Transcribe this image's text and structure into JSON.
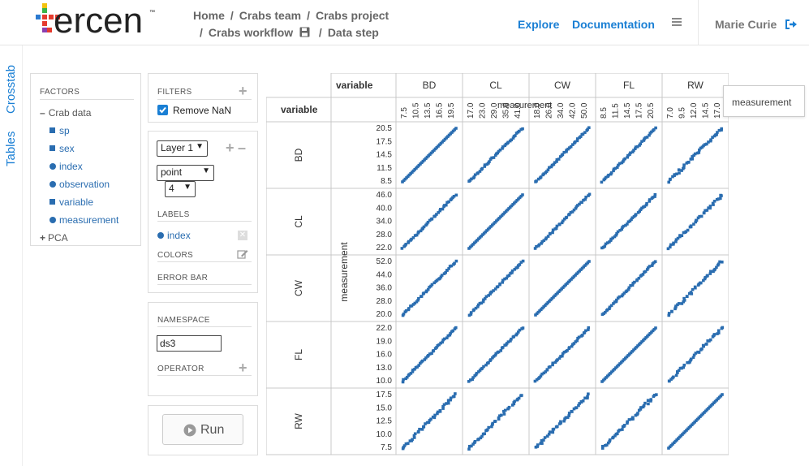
{
  "header": {
    "logo_text": "ercen",
    "logo_tm": "™",
    "breadcrumb": [
      "Home",
      "Crabs team",
      "Crabs project",
      "Crabs workflow",
      "Data step"
    ],
    "links": [
      "Explore",
      "Documentation"
    ],
    "user": "Marie Curie",
    "colors": {
      "link": "#1a7fd4",
      "logo_red": "#e53b2e",
      "logo_green": "#3bb44a",
      "logo_blue": "#2b7ad0",
      "logo_yellow": "#f4c20d",
      "logo_purple": "#8b3fb0"
    }
  },
  "side_tabs": [
    "Crosstab",
    "Tables"
  ],
  "factors": {
    "title": "FACTORS",
    "group": "Crab data",
    "items": [
      {
        "label": "sp",
        "kind": "square"
      },
      {
        "label": "sex",
        "kind": "square"
      },
      {
        "label": "index",
        "kind": "circle"
      },
      {
        "label": "observation",
        "kind": "circle"
      },
      {
        "label": "variable",
        "kind": "square"
      },
      {
        "label": "measurement",
        "kind": "circle"
      }
    ],
    "collapsed_group": "PCA"
  },
  "filters": {
    "title": "FILTERS",
    "remove_nan_label": "Remove NaN",
    "remove_nan_checked": true
  },
  "layer": {
    "layer_value": "Layer 1",
    "geom_value": "point",
    "size_value": "4",
    "labels_title": "LABELS",
    "label_item": "index",
    "colors_title": "COLORS",
    "error_bar_title": "ERROR BAR"
  },
  "namespace": {
    "title": "NAMESPACE",
    "value": "ds3",
    "operator_title": "OPERATOR"
  },
  "run_label": "Run",
  "tooltip": "measurement",
  "chart_data": {
    "type": "scatter",
    "corner_label": "variable",
    "row_header": "variable",
    "col_header_label": "variable",
    "xlabel": "measurement",
    "ylabel": "measurement",
    "variables": [
      "BD",
      "CL",
      "CW",
      "FL",
      "RW"
    ],
    "x_ticks": {
      "BD": [
        "7.5",
        "10.5",
        "13.5",
        "16.5",
        "19.5"
      ],
      "CL": [
        "17.0",
        "23.0",
        "29.0",
        "35.0",
        "41.0"
      ],
      "CW": [
        "18.0",
        "26.0",
        "34.0",
        "42.0",
        "50.0"
      ],
      "FL": [
        "8.5",
        "11.5",
        "14.5",
        "17.5",
        "20.5"
      ],
      "RW": [
        "7.0",
        "9.5",
        "12.0",
        "14.5",
        "17.0"
      ]
    },
    "y_ticks": {
      "BD": [
        "20.5",
        "17.5",
        "14.5",
        "11.5",
        "8.5"
      ],
      "CL": [
        "46.0",
        "40.0",
        "34.0",
        "28.0",
        "22.0"
      ],
      "CW": [
        "52.0",
        "44.0",
        "36.0",
        "28.0",
        "20.0"
      ],
      "FL": [
        "22.0",
        "19.0",
        "16.0",
        "13.0",
        "10.0"
      ],
      "RW": [
        "17.5",
        "15.0",
        "12.5",
        "10.0",
        "7.5"
      ]
    },
    "ranges": {
      "BD": [
        6.1,
        21.6
      ],
      "CL": [
        14.7,
        47.6
      ],
      "CW": [
        17.1,
        54.6
      ],
      "FL": [
        7.2,
        23.1
      ],
      "RW": [
        6.5,
        17.7
      ]
    },
    "point_color": "#2a6db0"
  }
}
